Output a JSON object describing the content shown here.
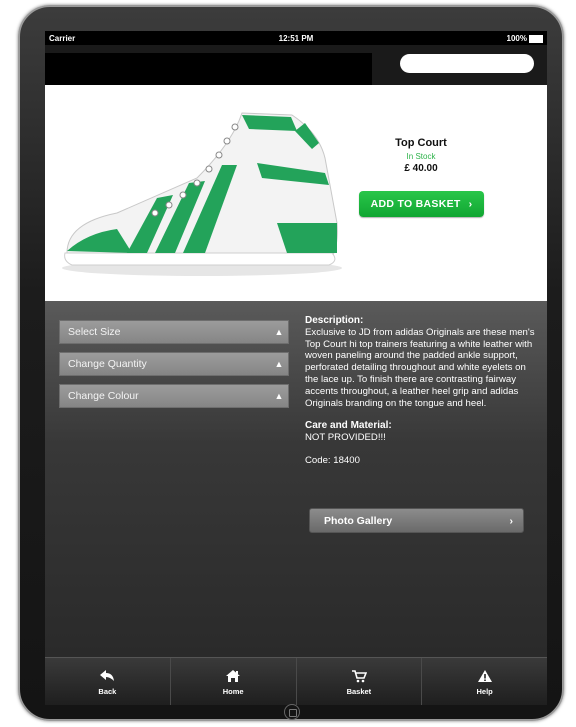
{
  "status_bar": {
    "carrier": "Carrier",
    "time": "12:51 PM",
    "battery": "100%"
  },
  "search": {
    "placeholder": ""
  },
  "product": {
    "name": "Top Court",
    "stock": "In Stock",
    "price": "£ 40.00",
    "add_to_basket_label": "ADD TO BASKET",
    "image_icon": "sneaker-image"
  },
  "options": [
    {
      "label": "Select Size"
    },
    {
      "label": "Change Quantity"
    },
    {
      "label": "Change Colour"
    }
  ],
  "description": {
    "heading": "Description:",
    "text": "Exclusive to JD from adidas Originals are these men's Top Court hi top trainers featuring a white leather with woven paneling around the padded ankle support, perforated detailing throughout and white eyelets on the lace up. To finish there are contrasting fairway accents throughout, a leather heel grip and adidas Originals branding on the tongue and heel.",
    "care_heading": "Care and Material:",
    "care_text": "NOT PROVIDED!!!",
    "code": "Code: 18400"
  },
  "photo_gallery_label": "Photo Gallery",
  "tabs": [
    {
      "label": "Back",
      "icon": "back-arrow-icon"
    },
    {
      "label": "Home",
      "icon": "home-icon"
    },
    {
      "label": "Basket",
      "icon": "basket-icon"
    },
    {
      "label": "Help",
      "icon": "warning-icon"
    }
  ],
  "colors": {
    "accent_green": "#19b43c",
    "stock_green": "#2db34a",
    "panel_dark": "#2a2a2a"
  }
}
